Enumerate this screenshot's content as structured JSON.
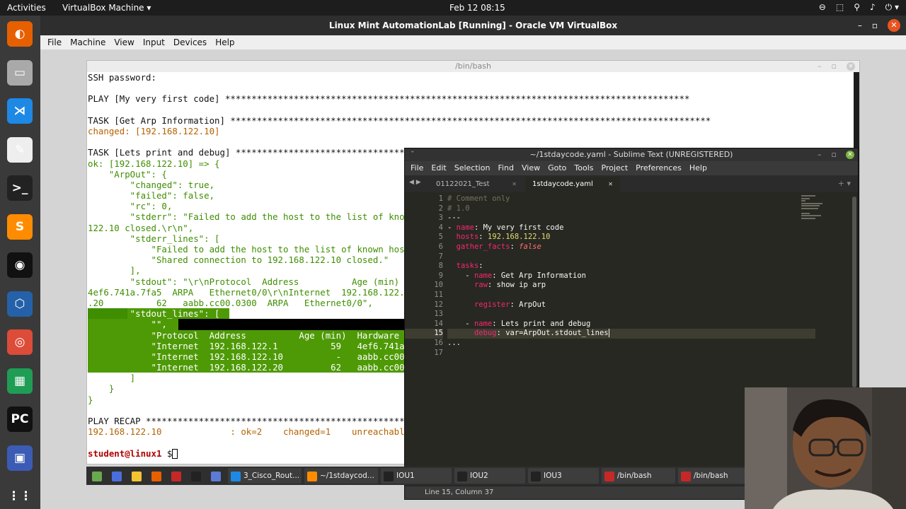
{
  "topbar": {
    "activities": "Activities",
    "app": "VirtualBox Machine ▾",
    "clock": "Feb 12  08:15",
    "tray": [
      "⊖",
      "⬚",
      "⚲",
      "♪",
      "⏻ ▾"
    ]
  },
  "dock": {
    "items": [
      {
        "name": "firefox-icon",
        "glyph": "◐",
        "color": "#e66000"
      },
      {
        "name": "files-icon",
        "glyph": "▭",
        "color": "#a9a9a9"
      },
      {
        "name": "vscode-icon",
        "glyph": "⋊",
        "color": "#1e88e5"
      },
      {
        "name": "text-editor-icon",
        "glyph": "✎",
        "color": "#eeeeee"
      },
      {
        "name": "terminal-icon",
        "glyph": ">_",
        "color": "#222222"
      },
      {
        "name": "sublime-icon",
        "glyph": "S",
        "color": "#ff8c00"
      },
      {
        "name": "obs-icon",
        "glyph": "◉",
        "color": "#111111"
      },
      {
        "name": "virtualbox-icon",
        "glyph": "⬡",
        "color": "#2561a8"
      },
      {
        "name": "chrome-icon",
        "glyph": "◎",
        "color": "#dd4b39"
      },
      {
        "name": "spreadsheet-icon",
        "glyph": "▦",
        "color": "#1f9d55"
      },
      {
        "name": "pycharm-icon",
        "glyph": "PC",
        "color": "#111111"
      },
      {
        "name": "remote-desktop-icon",
        "glyph": "▣",
        "color": "#3b5bb5"
      },
      {
        "name": "show-apps-icon",
        "glyph": "⋮⋮",
        "color": "#3a3a3a"
      }
    ]
  },
  "vbox": {
    "title": "Linux Mint AutomationLab [Running] - Oracle VM VirtualBox",
    "controls": [
      "–",
      "▫",
      "✕"
    ],
    "menu": [
      "File",
      "Machine",
      "View",
      "Input",
      "Devices",
      "Help"
    ]
  },
  "terminal": {
    "title": "/bin/bash",
    "controls": [
      "–",
      "▫",
      "✕"
    ],
    "lines": [
      {
        "text": "SSH password:",
        "cls": "tk"
      },
      {
        "text": "",
        "cls": "tk"
      },
      {
        "text": "PLAY [My very first code] ****************************************************************************************",
        "cls": "tk"
      },
      {
        "text": "",
        "cls": "tk"
      },
      {
        "text": "TASK [Get Arp Information] *******************************************************************************************",
        "cls": "tk"
      },
      {
        "text": "changed: [192.168.122.10]",
        "cls": "or"
      },
      {
        "text": "",
        "cls": "tk"
      },
      {
        "text": "TASK [Lets print and debug] *****************************************************************************************",
        "cls": "tk"
      },
      {
        "text": "ok: [192.168.122.10] => {",
        "cls": "gr"
      },
      {
        "text": "    \"ArpOut\": {",
        "cls": "gr"
      },
      {
        "text": "        \"changed\": true,",
        "cls": "gr"
      },
      {
        "text": "        \"failed\": false,",
        "cls": "gr"
      },
      {
        "text": "        \"rc\": 0,",
        "cls": "gr"
      },
      {
        "text": "        \"stderr\": \"Failed to add the host to the list of known hosts (/home/student/.ssh/known_hosts).\\r\\nShared connection to 192.168.",
        "cls": "gr"
      },
      {
        "text": "122.10 closed.\\r\\n\",",
        "cls": "gr"
      },
      {
        "text": "        \"stderr_lines\": [",
        "cls": "gr"
      },
      {
        "text": "            \"Failed to add the host to the list of known hosts (/home/student/.ssh/known_hosts).\",",
        "cls": "gr"
      },
      {
        "text": "            \"Shared connection to 192.168.122.10 closed.\"",
        "cls": "gr"
      },
      {
        "text": "        ],",
        "cls": "gr"
      },
      {
        "text": "        \"stdout\": \"\\r\\nProtocol  Address          Age (min)  Hardware Addr   Type   Interface\\r\\nInternet  192.168.122.1          59   52",
        "cls": "gr"
      },
      {
        "text": "4ef6.741a.7fa5  ARPA   Ethernet0/0\\r\\nInternet  192.168.122.10          -   aabb.cc00.0300  ARPA   Ethernet0/0\\r\\nInternet  192.168.122",
        "cls": "gr"
      },
      {
        "text": ".20          62   aabb.cc00.0300  ARPA   Ethernet0/0\",",
        "cls": "gr"
      }
    ],
    "hl_lines": [
      "        \"stdout_lines\": [",
      "            \"\",",
      "            \"Protocol  Address          Age (min)  Hardware Addr   Type   Interface\",",
      "            \"Internet  192.168.122.1          59   4ef6.741a.7fa5  ARPA   Ethernet0/0\",",
      "            \"Internet  192.168.122.10          -   aabb.cc00.0300  ARPA   Ethernet0/0\",",
      "            \"Internet  192.168.122.20         62   aabb.cc00.0300  ARPA   Ethernet0/0\""
    ],
    "tail_lines": [
      {
        "text": "        ]",
        "cls": "gr"
      },
      {
        "text": "    }",
        "cls": "gr"
      },
      {
        "text": "}",
        "cls": "gr"
      },
      {
        "text": "",
        "cls": "tk"
      },
      {
        "text": "PLAY RECAP *******************************************************************************************************",
        "cls": "tk"
      },
      {
        "text": "192.168.122.10             : ok=2    changed=1    unreachable=0    failed=0    skipped=0    rescued=0    ignored=0",
        "cls": "or"
      },
      {
        "text": "",
        "cls": "tk"
      }
    ],
    "prompt_user": "student@linux1",
    "prompt_sym": " $"
  },
  "sublime": {
    "title": "~/1stdaycode.yaml - Sublime Text (UNREGISTERED)",
    "controls": [
      "–",
      "▫"
    ],
    "close": "✕",
    "left_ctl": "ˇ",
    "menu": [
      "File",
      "Edit",
      "Selection",
      "Find",
      "View",
      "Goto",
      "Tools",
      "Project",
      "Preferences",
      "Help"
    ],
    "tab_nav": "◀ ▶",
    "tabs": [
      {
        "label": "01122021_Test",
        "close": "✕"
      },
      {
        "label": "1stdaycode.yaml",
        "close": "✕"
      }
    ],
    "tab_extra": "+  ▾",
    "line_numbers": [
      "1",
      "2",
      "3",
      "4",
      "5",
      "6",
      "7",
      "8",
      "9",
      "10",
      "11",
      "12",
      "13",
      "14",
      "15",
      "16",
      "17"
    ],
    "current_line": 15,
    "code": [
      [
        {
          "t": "# Comment only",
          "c": "cm"
        }
      ],
      [
        {
          "t": "# 1.0",
          "c": "cm"
        }
      ],
      [
        {
          "t": "---",
          "c": "vl"
        }
      ],
      [
        {
          "t": "- ",
          "c": "vl"
        },
        {
          "t": "name",
          "c": "ky"
        },
        {
          "t": ": ",
          "c": "vl"
        },
        {
          "t": "My very first code",
          "c": "vl"
        }
      ],
      [
        {
          "t": "  ",
          "c": "vl"
        },
        {
          "t": "hosts",
          "c": "ky"
        },
        {
          "t": ": ",
          "c": "vl"
        },
        {
          "t": "192.168.122.10",
          "c": "st"
        }
      ],
      [
        {
          "t": "  ",
          "c": "vl"
        },
        {
          "t": "gather_facts",
          "c": "ky"
        },
        {
          "t": ": ",
          "c": "vl"
        },
        {
          "t": "false",
          "c": "bl"
        }
      ],
      [
        {
          "t": "",
          "c": "vl"
        }
      ],
      [
        {
          "t": "  ",
          "c": "vl"
        },
        {
          "t": "tasks",
          "c": "ky"
        },
        {
          "t": ":",
          "c": "vl"
        }
      ],
      [
        {
          "t": "    - ",
          "c": "vl"
        },
        {
          "t": "name",
          "c": "ky"
        },
        {
          "t": ": Get Arp Information",
          "c": "vl"
        }
      ],
      [
        {
          "t": "      ",
          "c": "vl"
        },
        {
          "t": "raw",
          "c": "ky"
        },
        {
          "t": ": show ip arp",
          "c": "vl"
        }
      ],
      [
        {
          "t": "",
          "c": "vl"
        }
      ],
      [
        {
          "t": "      ",
          "c": "vl"
        },
        {
          "t": "register",
          "c": "ky"
        },
        {
          "t": ": ArpOut",
          "c": "vl"
        }
      ],
      [
        {
          "t": "",
          "c": "vl"
        }
      ],
      [
        {
          "t": "    - ",
          "c": "vl"
        },
        {
          "t": "name",
          "c": "ky"
        },
        {
          "t": ": Lets print and debug",
          "c": "vl"
        }
      ],
      [
        {
          "t": "      ",
          "c": "vl"
        },
        {
          "t": "debug",
          "c": "ky"
        },
        {
          "t": ": var=ArpOut.stdout_lines",
          "c": "vl"
        }
      ],
      [
        {
          "t": "...",
          "c": "vl"
        }
      ],
      [
        {
          "t": "",
          "c": "vl"
        }
      ]
    ],
    "status": "Line 15, Column 37"
  },
  "taskbar": {
    "items": [
      {
        "label": "",
        "icon": "#6aa84f"
      },
      {
        "label": "",
        "icon": "#4a6fdc"
      },
      {
        "label": "",
        "icon": "#f4c430"
      },
      {
        "label": "",
        "icon": "#e66000"
      },
      {
        "label": "",
        "icon": "#c62828"
      },
      {
        "label": "",
        "icon": "#222222"
      },
      {
        "label": "",
        "icon": "#5b7bd5"
      },
      {
        "label": "3_Cisco_Rout...",
        "icon": "#1e88e5"
      },
      {
        "label": "~/1stdaycod...",
        "icon": "#ff8c00"
      },
      {
        "label": "IOU1",
        "icon": "#222222"
      },
      {
        "label": "IOU2",
        "icon": "#222222"
      },
      {
        "label": "IOU3",
        "icon": "#222222"
      },
      {
        "label": "/bin/bash",
        "icon": "#c62828"
      },
      {
        "label": "/bin/bash",
        "icon": "#c62828"
      },
      {
        "label": "",
        "icon": "#7cb342"
      }
    ]
  }
}
